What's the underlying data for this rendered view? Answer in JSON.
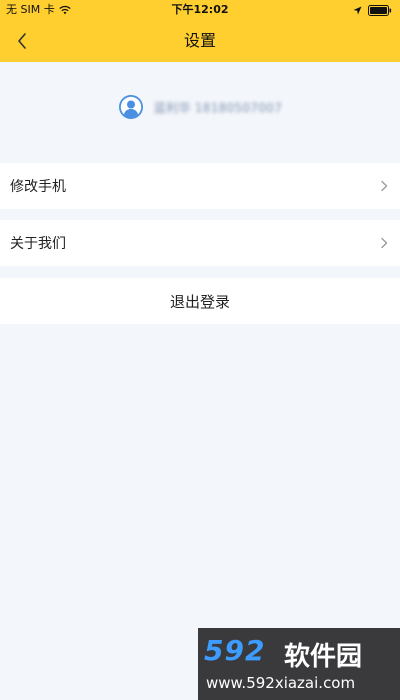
{
  "status_bar": {
    "carrier": "无 SIM 卡",
    "time": "下午12:02",
    "icons": [
      "wifi-icon",
      "location-icon",
      "battery-icon"
    ]
  },
  "nav": {
    "title": "设置",
    "back_icon": "chevron-left-icon"
  },
  "profile": {
    "avatar_icon": "user-avatar-icon",
    "name": "蓝利华 18180507007"
  },
  "menu": {
    "items": [
      {
        "label": "修改手机",
        "icon": "chevron-right-icon"
      },
      {
        "label": "关于我们",
        "icon": "chevron-right-icon"
      }
    ]
  },
  "logout": {
    "label": "退出登录"
  },
  "watermark": {
    "brand": "592",
    "name": "软件园",
    "url": "www.592xiazai.com"
  },
  "colors": {
    "header": "#ffce2f",
    "background": "#f3f6fa",
    "avatar": "#4a90e2",
    "watermark_bg": "#3a3a3d",
    "watermark_brand": "#3d9cff"
  }
}
